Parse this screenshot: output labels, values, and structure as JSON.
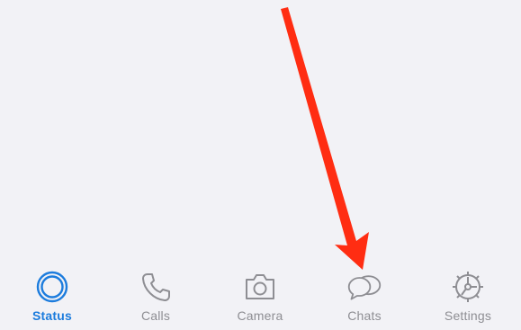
{
  "colors": {
    "background": "#f2f2f6",
    "active": "#1c7cdd",
    "inactive": "#8e8e93",
    "annotation_arrow": "#ff2d12"
  },
  "tabbar": {
    "active_tab": "Status",
    "tabs": [
      {
        "label": "Status",
        "icon": "status-rings-icon"
      },
      {
        "label": "Calls",
        "icon": "phone-icon"
      },
      {
        "label": "Camera",
        "icon": "camera-icon"
      },
      {
        "label": "Chats",
        "icon": "chat-bubbles-icon"
      },
      {
        "label": "Settings",
        "icon": "gear-icon"
      }
    ]
  },
  "annotation": {
    "icon": "red-arrow-icon",
    "points_to": "Chats"
  }
}
